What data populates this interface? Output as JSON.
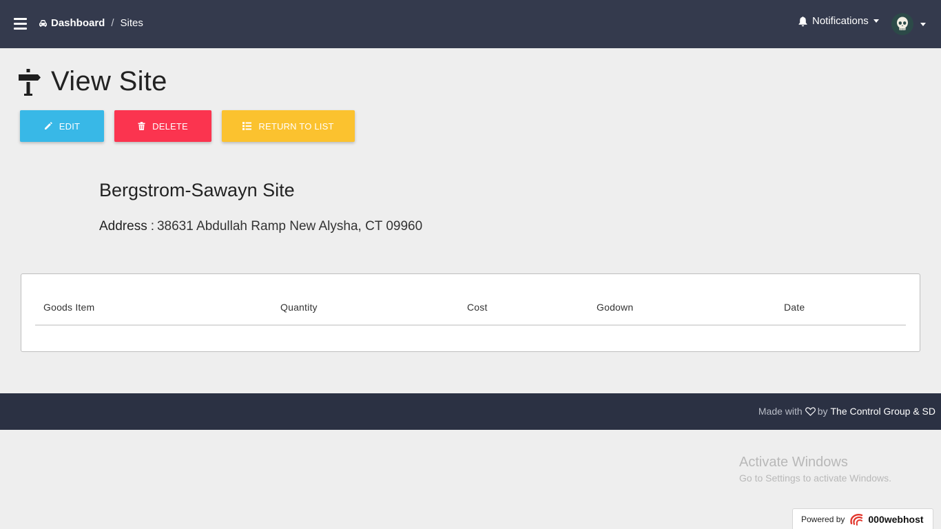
{
  "navbar": {
    "breadcrumb_home": "Dashboard",
    "breadcrumb_separator": "/",
    "breadcrumb_current": "Sites",
    "notifications_label": "Notifications",
    "home_icon": "car-icon",
    "bell_icon": "bell-icon",
    "avatar_icon": "skull-icon"
  },
  "page": {
    "title": "View Site",
    "title_icon": "signpost-icon"
  },
  "actions": {
    "edit_label": "EDIT",
    "delete_label": "DELETE",
    "return_label": "RETURN TO LIST",
    "edit_color": "#38b8e7",
    "delete_color": "#fb344f",
    "return_color": "#fbc22f"
  },
  "site": {
    "name": "Bergstrom-Sawayn Site",
    "address_label": "Address",
    "address_separator": ":",
    "address_value": "38631 Abdullah Ramp New Alysha, CT 09960"
  },
  "table": {
    "columns": [
      "Goods Item",
      "Quantity",
      "Cost",
      "Godown",
      "Date"
    ],
    "rows": []
  },
  "footer": {
    "made_with": "Made with",
    "by": "by",
    "brand": "The Control Group & SD"
  },
  "watermark": {
    "title": "Activate Windows",
    "subtitle": "Go to Settings to activate Windows."
  },
  "powered": {
    "label": "Powered by",
    "host": "000webhost"
  }
}
